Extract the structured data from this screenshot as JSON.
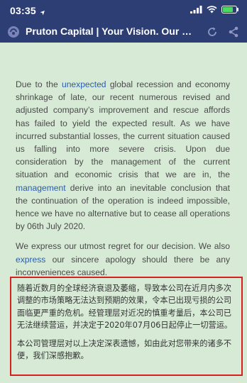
{
  "status_bar": {
    "time": "03:35",
    "location_arrow": "➤",
    "battery_level": 0.85,
    "battery_color": "#4cd964"
  },
  "browser": {
    "page_title": "Pruton Capital | Your Vision. Our Exp...",
    "icons": [
      "site-icon",
      "reload-icon",
      "share-icon"
    ]
  },
  "notice_en": {
    "p1_a": "Due to the ",
    "p1_link1": "unexpected",
    "p1_b": " global recession and economy shrinkage of late, our recent numerous revised and adjusted company’s improvement and rescue affords has failed to yield the expected result. As we have incurred substantial losses, the current situation caused us falling into more severe crisis. Upon due consideration by the management of the current situation and economic crisis that we are in, the ",
    "p1_link2": "management",
    "p1_c": " derive into an inevitable conclusion that the continuation of the operation is indeed impossible, hence we have no alternative but to cease all operations by 06th July 2020.",
    "p2_a": "We express our utmost regret for our decision. We also ",
    "p2_link": "express",
    "p2_b": " our sincere apology should there be any inconveniences caused."
  },
  "notice_zh": {
    "p1": "随着近数月的全球经济衰退及萎缩，导致本公司在近月内多次调整的市场策略无法达到预期的效果，令本已出现亏损的公司面临更严重的危机。经管理层对近况的慎重考量后，本公司已无法继续营运，并决定于2020年07月06日起停止一切营运。",
    "p2": "本公司管理层对以上决定深表遗憾，如由此对您带来的诸多不便，我们深感抱歉。"
  },
  "colors": {
    "header_bg": "#2c3e73",
    "page_bg": "#d6ead6",
    "link": "#2a5db0",
    "highlight_border": "#d62020"
  }
}
